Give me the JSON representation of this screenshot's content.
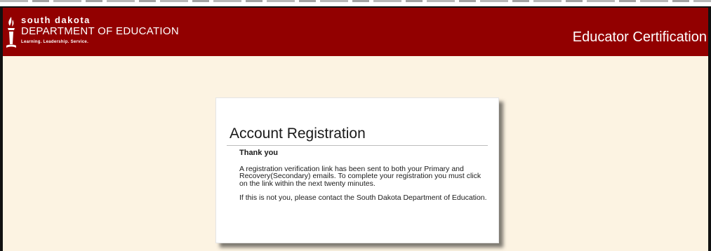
{
  "brand": {
    "line1": "south dakota",
    "line2": "DEPARTMENT OF EDUCATION",
    "tagline": "Learning. Leadership. Service."
  },
  "header": {
    "app_title": "Educator Certification"
  },
  "colors": {
    "header_bg": "#920000",
    "page_bg": "#fcf3e2",
    "card_bg": "#ffffff"
  },
  "card": {
    "title": "Account Registration",
    "heading": "Thank you",
    "paragraph1": "A registration verification link has been sent to both your Primary and Recovery(Secondary) emails. To complete your registration you must click on the link within the next twenty minutes.",
    "paragraph2": "If this is not you, please contact the South Dakota Department of Education."
  }
}
